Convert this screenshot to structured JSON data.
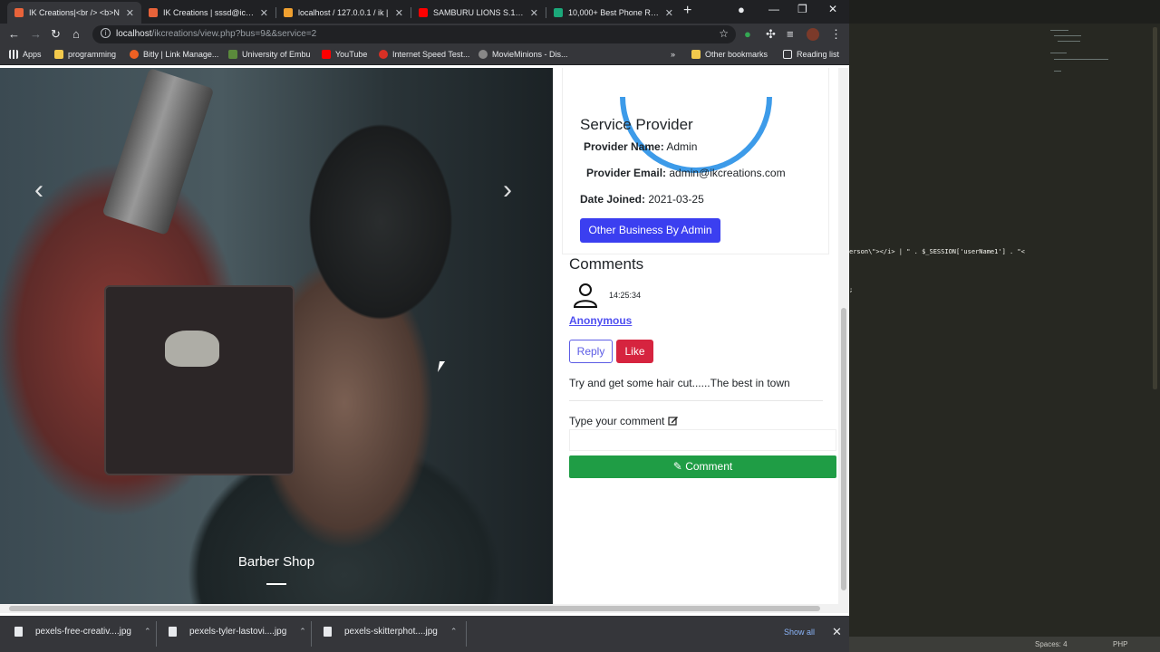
{
  "browser": {
    "tabs": [
      {
        "title": "IK Creations|<br /> <b>N",
        "active": true,
        "favicon_color": "#e8633a"
      },
      {
        "title": "IK Creations | sssd@icreati",
        "active": false,
        "favicon_color": "#e8633a"
      },
      {
        "title": "localhost / 127.0.0.1 / ik |",
        "active": false,
        "favicon_color": "#f0a030"
      },
      {
        "title": "SAMBURU LIONS S.1 E.9",
        "active": false,
        "favicon_color": "#ff0000"
      },
      {
        "title": "10,000+ Best Phone Repa",
        "active": false,
        "favicon_color": "#1ba87a"
      }
    ],
    "url_host": "localhost",
    "url_path": "/ikcreations/view.php?bus=9&&service=2",
    "bookmarks": [
      {
        "label": "Apps",
        "icon_color": "#e8eaed"
      },
      {
        "label": "programming",
        "icon_color": "#f2c94c"
      },
      {
        "label": "Bitly | Link Manage...",
        "icon_color": "#ee6123"
      },
      {
        "label": "University of Embu",
        "icon_color": "#5b8a3c"
      },
      {
        "label": "YouTube",
        "icon_color": "#ff0000"
      },
      {
        "label": "Internet Speed Test...",
        "icon_color": "#d93025"
      },
      {
        "label": "MovieMinions - Dis...",
        "icon_color": "#888888"
      }
    ],
    "bookmarks_more": "»",
    "other_bookmarks": "Other bookmarks",
    "reading_list": "Reading list"
  },
  "hero": {
    "caption": "Barber Shop",
    "prev_icon": "chevron-left-icon",
    "next_icon": "chevron-right-icon"
  },
  "provider": {
    "title": "Service Provider",
    "name_label": "Provider Name:",
    "name_value": "Admin",
    "email_label": "Provider Email:",
    "email_value": "admin@ikcreations.com",
    "joined_label": "Date Joined:",
    "joined_value": "2021-03-25",
    "other_business_button": "Other Business By Admin",
    "accent_color": "#3b3ff0"
  },
  "comments": {
    "title": "Comments",
    "items": [
      {
        "time": "14:25:34",
        "author": "Anonymous",
        "text": "Try and get some hair cut......The best in town"
      }
    ],
    "reply_label": "Reply",
    "like_label": "Like",
    "input_label": "Type your comment",
    "input_value": "",
    "submit_label": "Comment",
    "like_color": "#d6243f",
    "submit_color": "#1f9d45"
  },
  "downloads": {
    "items": [
      "pexels-free-creativ....jpg",
      "pexels-tyler-lastovi....jpg",
      "pexels-skitterphot....jpg"
    ],
    "show_all": "Show all"
  },
  "editor": {
    "code_line_1": "erson\\\"></i> | \" . $_SESSION['userName1'] . \"<",
    "code_line_2": ";",
    "status_spaces": "Spaces: 4",
    "status_lang": "PHP"
  }
}
